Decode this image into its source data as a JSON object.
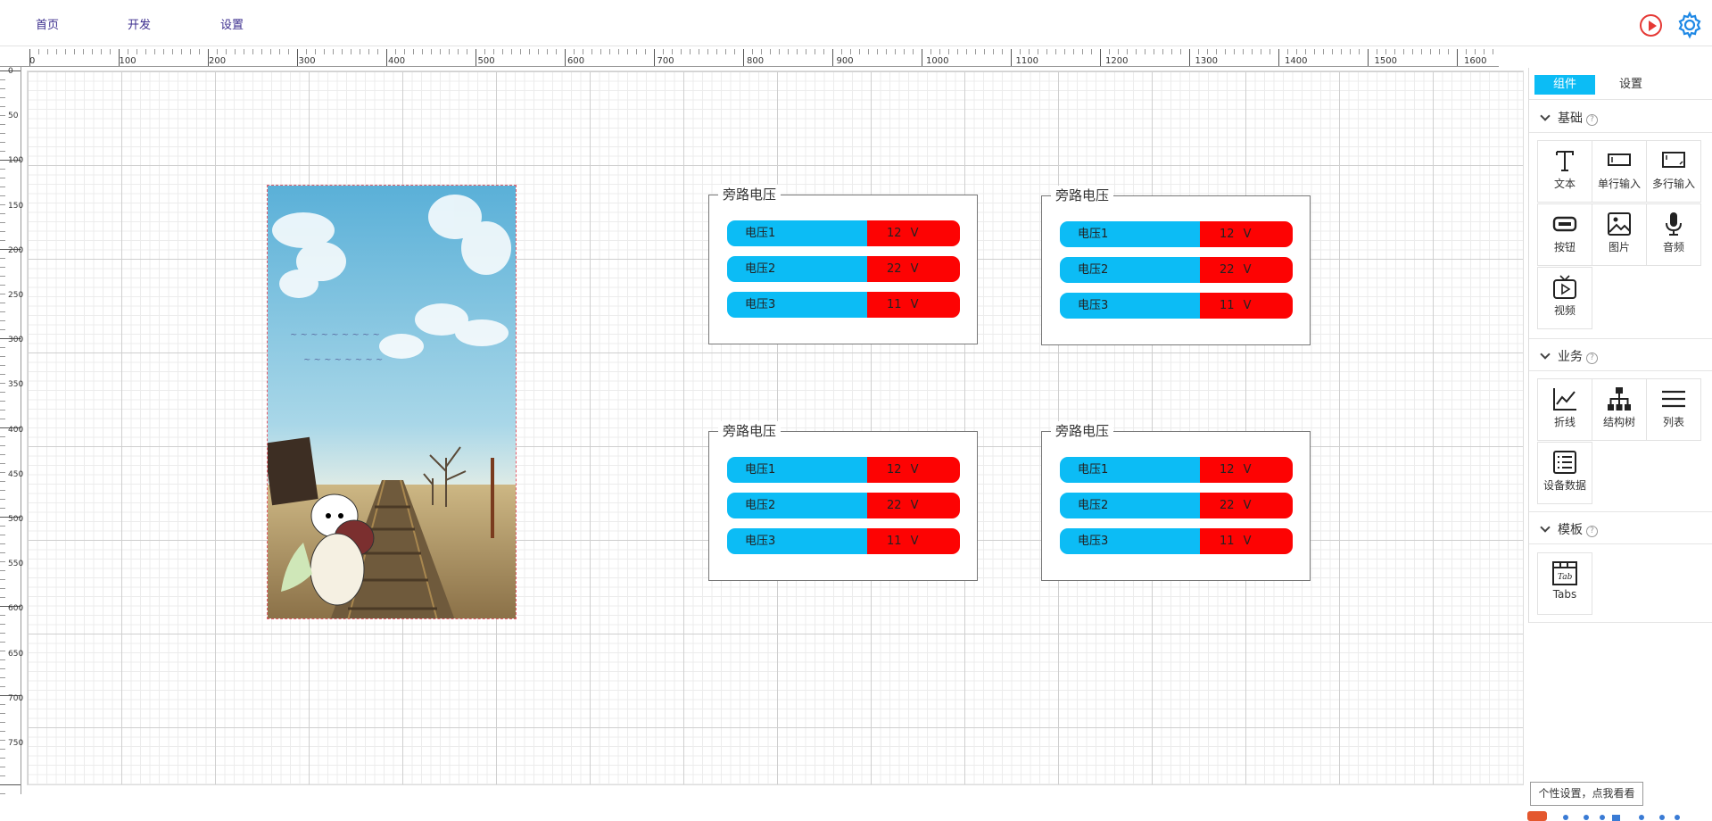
{
  "nav": {
    "home": "首页",
    "develop": "开发",
    "settings": "设置"
  },
  "header_icons": [
    "play-icon",
    "gear-icon"
  ],
  "ruler": {
    "top": [
      "0",
      "100",
      "200",
      "300",
      "400",
      "500",
      "600",
      "700",
      "800",
      "900",
      "1000",
      "1100",
      "1200",
      "1300",
      "1400",
      "1500",
      "1600"
    ],
    "left": [
      "0",
      "50",
      "100",
      "150",
      "200",
      "250",
      "300",
      "350",
      "400",
      "450",
      "500",
      "550",
      "600",
      "650",
      "700",
      "750"
    ]
  },
  "panels": [
    {
      "title": "旁路电压",
      "rows": [
        {
          "name": "电压1",
          "value": "12  V"
        },
        {
          "name": "电压2",
          "value": "22  V"
        },
        {
          "name": "电压3",
          "value": "11  V"
        }
      ]
    },
    {
      "title": "旁路电压",
      "rows": [
        {
          "name": "电压1",
          "value": "12  V"
        },
        {
          "name": "电压2",
          "value": "22  V"
        },
        {
          "name": "电压3",
          "value": "11  V"
        }
      ]
    },
    {
      "title": "旁路电压",
      "rows": [
        {
          "name": "电压1",
          "value": "12  V"
        },
        {
          "name": "电压2",
          "value": "22  V"
        },
        {
          "name": "电压3",
          "value": "11  V"
        }
      ]
    },
    {
      "title": "旁路电压",
      "rows": [
        {
          "name": "电压1",
          "value": "12  V"
        },
        {
          "name": "电压2",
          "value": "22  V"
        },
        {
          "name": "电压3",
          "value": "11  V"
        }
      ]
    }
  ],
  "sidebar": {
    "tabs": [
      "组件",
      "设置"
    ],
    "sections": [
      {
        "title": "基础",
        "items": [
          "文本",
          "单行输入",
          "多行输入",
          "按钮",
          "图片",
          "音频",
          "视频"
        ]
      },
      {
        "title": "业务",
        "items": [
          "折线",
          "结构树",
          "列表",
          "设备数据"
        ]
      },
      {
        "title": "模板",
        "items": [
          "Tabs"
        ]
      }
    ]
  },
  "tooltip": "个性设置，点我看看",
  "colors": {
    "label_bg": "#0cbcf5",
    "value_bg": "#fd0303",
    "nav_text": "#3d2f8f",
    "tab_active": "#0cbcf5"
  }
}
